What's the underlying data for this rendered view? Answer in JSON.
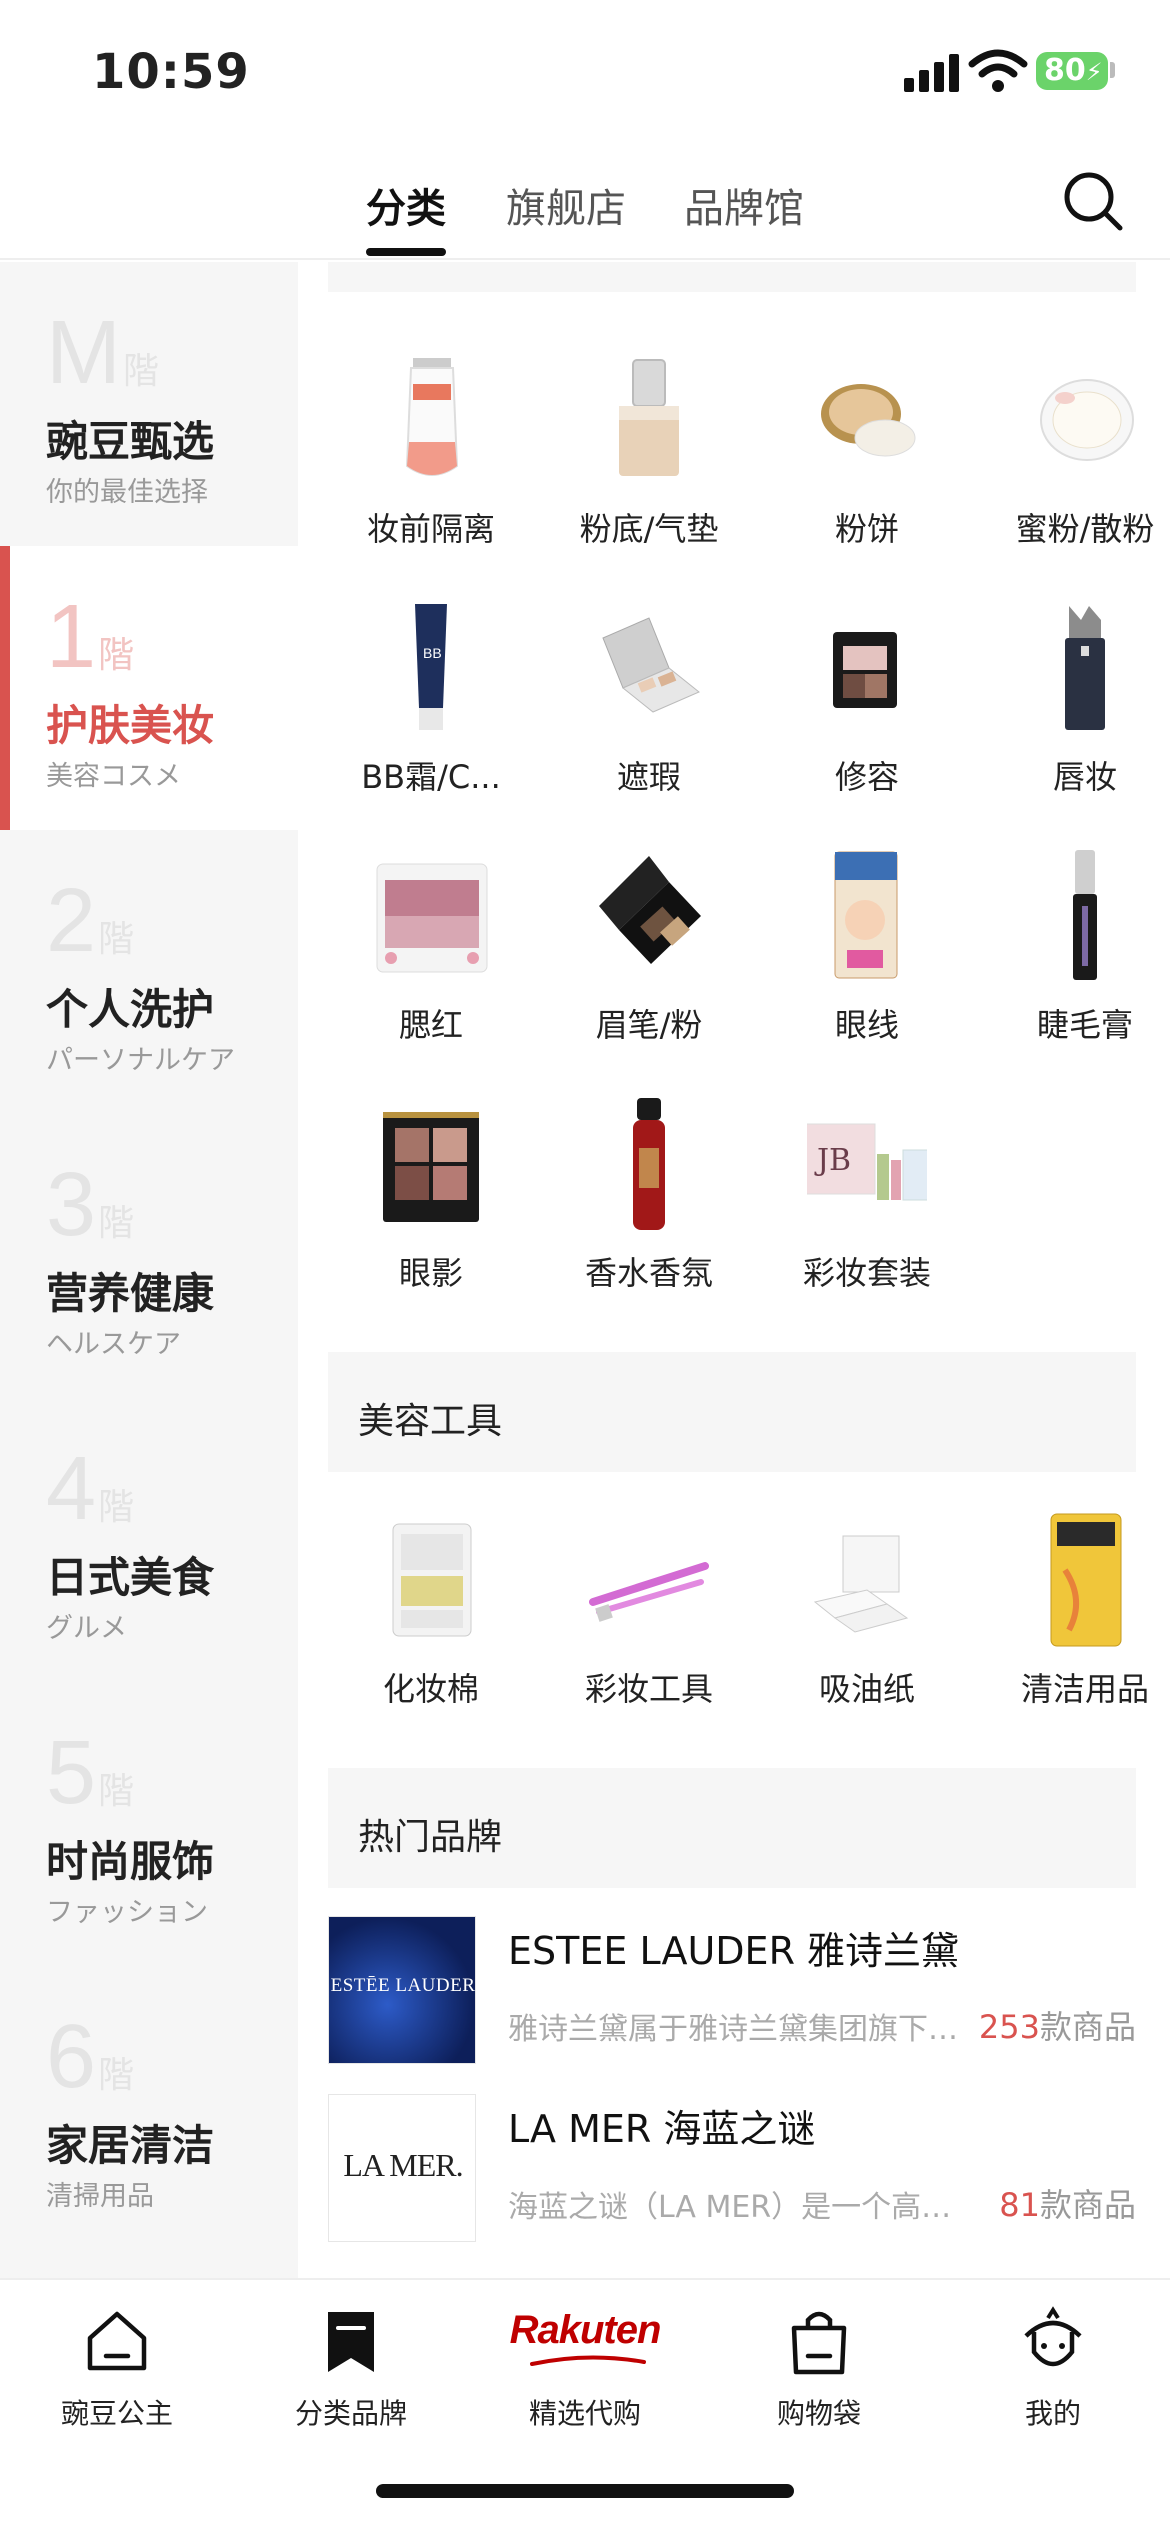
{
  "status_bar": {
    "time": "10:59",
    "battery": "80"
  },
  "top_tabs": [
    {
      "label": "分类",
      "active": true
    },
    {
      "label": "旗舰店",
      "active": false
    },
    {
      "label": "品牌馆",
      "active": false
    }
  ],
  "left_nav": [
    {
      "floor": "M",
      "kai": "階",
      "title": "豌豆甄选",
      "subtitle": "你的最佳选择",
      "active": false
    },
    {
      "floor": "1",
      "kai": "階",
      "title": "护肤美妆",
      "subtitle": "美容コスメ",
      "active": true
    },
    {
      "floor": "2",
      "kai": "階",
      "title": "个人洗护",
      "subtitle": "パーソナルケア",
      "active": false
    },
    {
      "floor": "3",
      "kai": "階",
      "title": "营养健康",
      "subtitle": "ヘルスケア",
      "active": false
    },
    {
      "floor": "4",
      "kai": "階",
      "title": "日式美食",
      "subtitle": "グルメ",
      "active": false
    },
    {
      "floor": "5",
      "kai": "階",
      "title": "时尚服饰",
      "subtitle": "ファッション",
      "active": false
    },
    {
      "floor": "6",
      "kai": "階",
      "title": "家居清洁",
      "subtitle": "清掃用品",
      "active": false
    }
  ],
  "makeup_categories": [
    {
      "label": "妆前隔离",
      "icon": "primer-tube"
    },
    {
      "label": "粉底/气垫",
      "icon": "foundation-bottle"
    },
    {
      "label": "粉饼",
      "icon": "powder-compact"
    },
    {
      "label": "蜜粉/散粉",
      "icon": "loose-powder"
    },
    {
      "label": "BB霜/C...",
      "icon": "bb-cream-tube"
    },
    {
      "label": "遮瑕",
      "icon": "concealer-palette"
    },
    {
      "label": "修容",
      "icon": "contour-palette"
    },
    {
      "label": "唇妆",
      "icon": "lipstick"
    },
    {
      "label": "腮红",
      "icon": "blush-compact"
    },
    {
      "label": "眉笔/粉",
      "icon": "brow-powder"
    },
    {
      "label": "眼线",
      "icon": "eyeliner"
    },
    {
      "label": "睫毛膏",
      "icon": "mascara"
    },
    {
      "label": "眼影",
      "icon": "eyeshadow-palette"
    },
    {
      "label": "香水香氛",
      "icon": "perfume-bottle"
    },
    {
      "label": "彩妆套装",
      "icon": "makeup-set"
    }
  ],
  "beauty_tools": {
    "title": "美容工具",
    "items": [
      {
        "label": "化妆棉",
        "icon": "cotton-pads"
      },
      {
        "label": "彩妆工具",
        "icon": "razor-tools"
      },
      {
        "label": "吸油纸",
        "icon": "blotting-paper"
      },
      {
        "label": "清洁用品",
        "icon": "cleaning-pack"
      }
    ]
  },
  "hot_brands": {
    "title": "热门品牌",
    "items": [
      {
        "logo_text": "ESTĒE LAUDER",
        "name": "ESTEE LAUDER 雅诗兰黛",
        "desc": "雅诗兰黛属于雅诗兰黛集团旗下…",
        "count": "253",
        "count_suffix": "款商品"
      },
      {
        "logo_text": "LA MER.",
        "name": "LA MER 海蓝之谜",
        "desc": "海蓝之谜（LA MER）是一个高端…",
        "count": "81",
        "count_suffix": "款商品"
      }
    ]
  },
  "bottom_nav": [
    {
      "label": "豌豆公主",
      "icon": "home-icon"
    },
    {
      "label": "分类品牌",
      "icon": "bookmark-icon"
    },
    {
      "label": "精选代购",
      "icon": "rakuten-logo",
      "logo_text": "Rakuten"
    },
    {
      "label": "购物袋",
      "icon": "bag-icon"
    },
    {
      "label": "我的",
      "icon": "profile-icon"
    }
  ],
  "colors": {
    "accent": "#d9534f",
    "nav_bg": "#f6f6f6",
    "rakuten": "#bf0000"
  }
}
